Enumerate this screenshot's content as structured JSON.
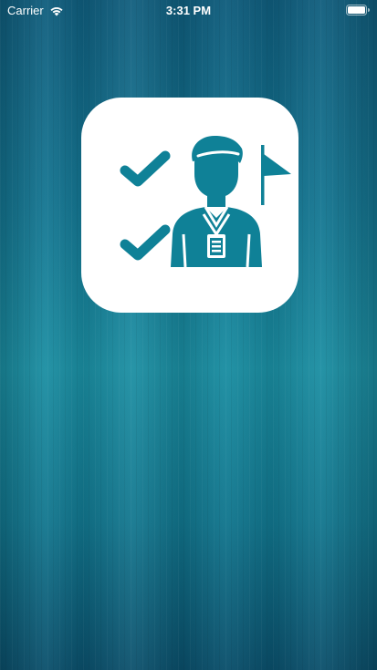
{
  "status_bar": {
    "carrier": "Carrier",
    "time": "3:31 PM",
    "wifi_icon": "wifi-icon",
    "battery_icon": "battery-full-icon"
  },
  "splash": {
    "logo_icon": "referee-checklist-icon",
    "icon_color": "#0f8197",
    "card_color": "#ffffff"
  }
}
